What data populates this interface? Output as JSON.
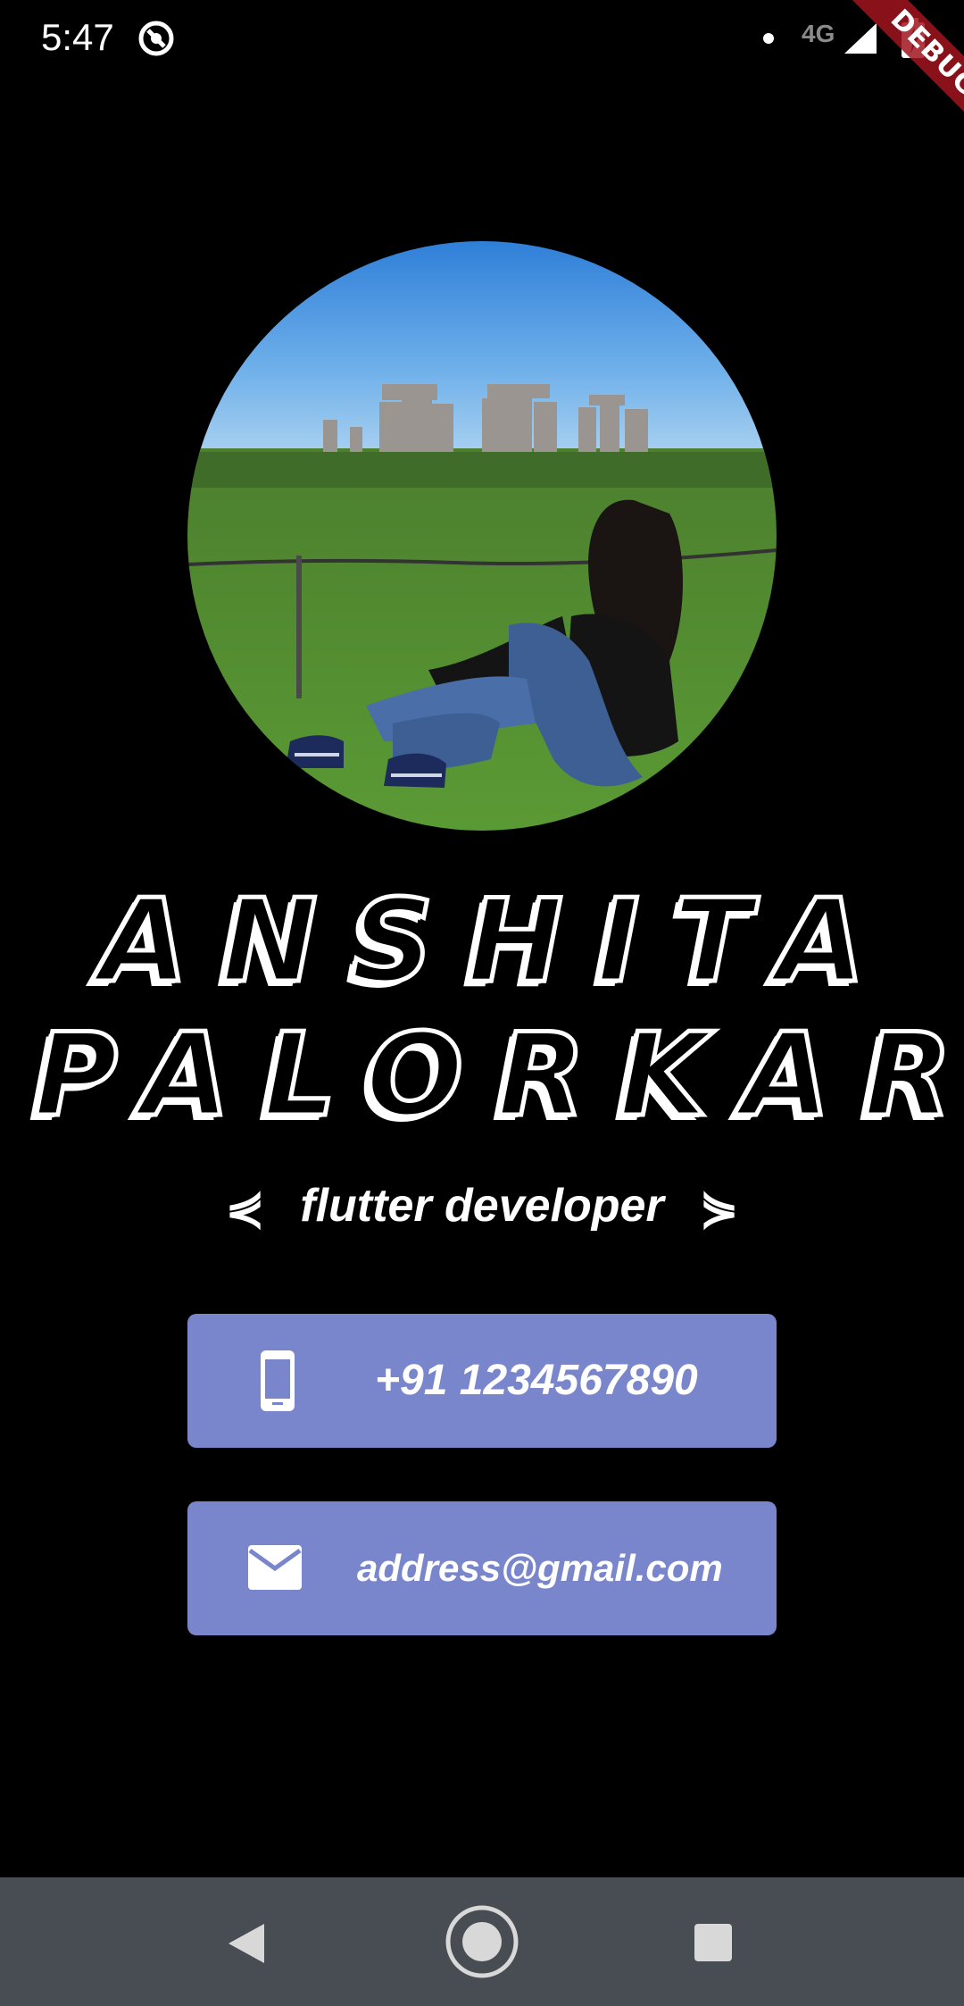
{
  "status_bar": {
    "time": "5:47",
    "network": "4G",
    "icons": [
      "app-notification-icon",
      "dot-icon",
      "signal-icon",
      "battery-charging-icon"
    ]
  },
  "debug_banner": {
    "label": "DEBUG",
    "color": "#a0141e"
  },
  "profile": {
    "first_name": "ANSHITA",
    "last_name": "PALORKAR",
    "title": "flutter developer",
    "title_prefix": "⋞",
    "title_suffix": "⋟"
  },
  "contact": {
    "phone": {
      "icon": "smartphone-icon",
      "value": "+91 1234567890"
    },
    "email": {
      "icon": "mail-icon",
      "value": "address@gmail.com"
    }
  },
  "colors": {
    "background": "#000000",
    "card": "#7986cb",
    "nav_bar": "#474d53",
    "text": "#ffffff"
  },
  "nav_bar": {
    "buttons": [
      "back-icon",
      "home-icon",
      "recents-icon"
    ]
  }
}
